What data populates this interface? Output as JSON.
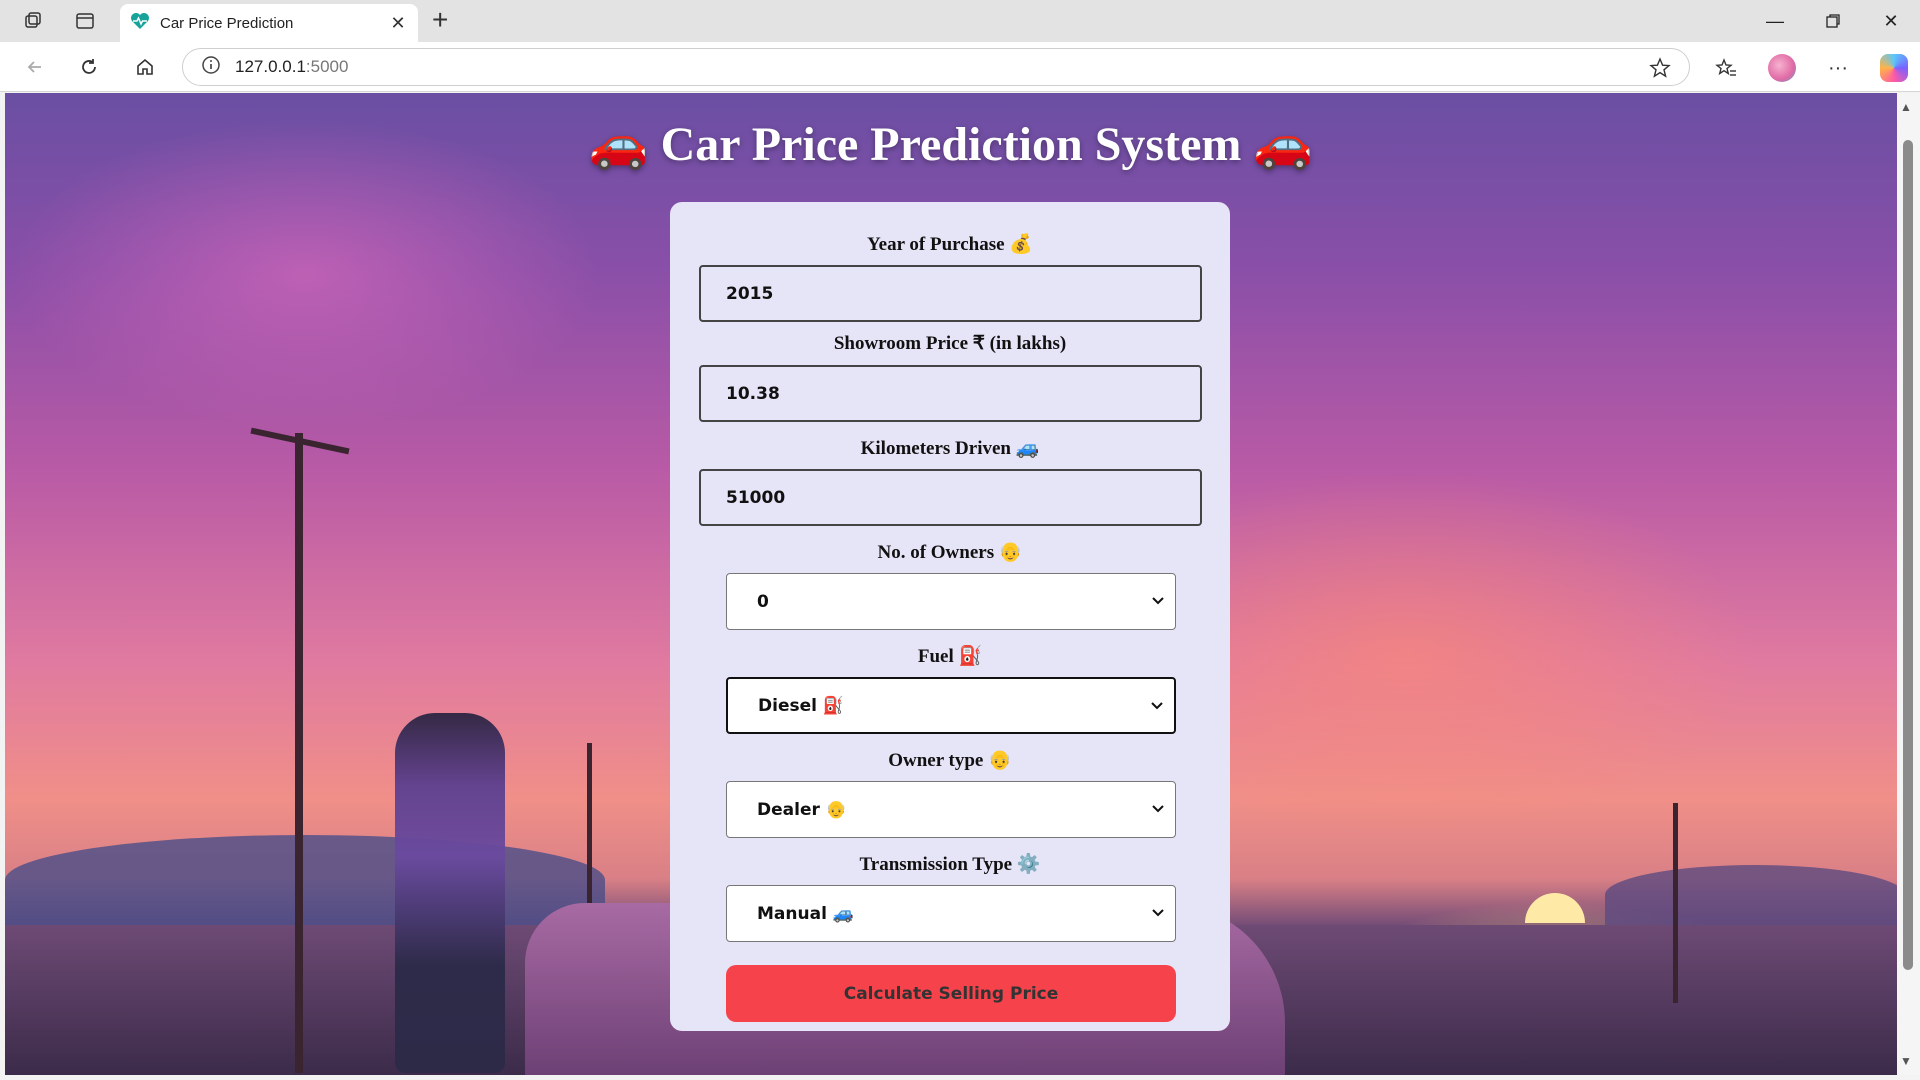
{
  "browser": {
    "tab_title": "Car Price Prediction",
    "url_host": "127.0.0.1",
    "url_port": ":5000"
  },
  "page": {
    "title": "🚗 Car Price Prediction System 🚗",
    "fields": {
      "year_label": "Year of Purchase 💰",
      "year_value": "2015",
      "price_label": "Showroom Price ₹ (in lakhs)",
      "price_value": "10.38",
      "km_label": "Kilometers Driven 🚙",
      "km_value": "51000",
      "owners_label": "No. of Owners 👴",
      "owners_value": "0",
      "fuel_label": "Fuel ⛽",
      "fuel_value": "Diesel ⛽",
      "owner_type_label": "Owner type 👴",
      "owner_type_value": "Dealer 👴",
      "transmission_label": "Transmission Type ⚙️",
      "transmission_value": "Manual 🚙"
    },
    "submit_label": "Calculate Selling Price"
  },
  "colors": {
    "accent_button": "#f6434b",
    "panel_bg": "#e6e4f7"
  }
}
